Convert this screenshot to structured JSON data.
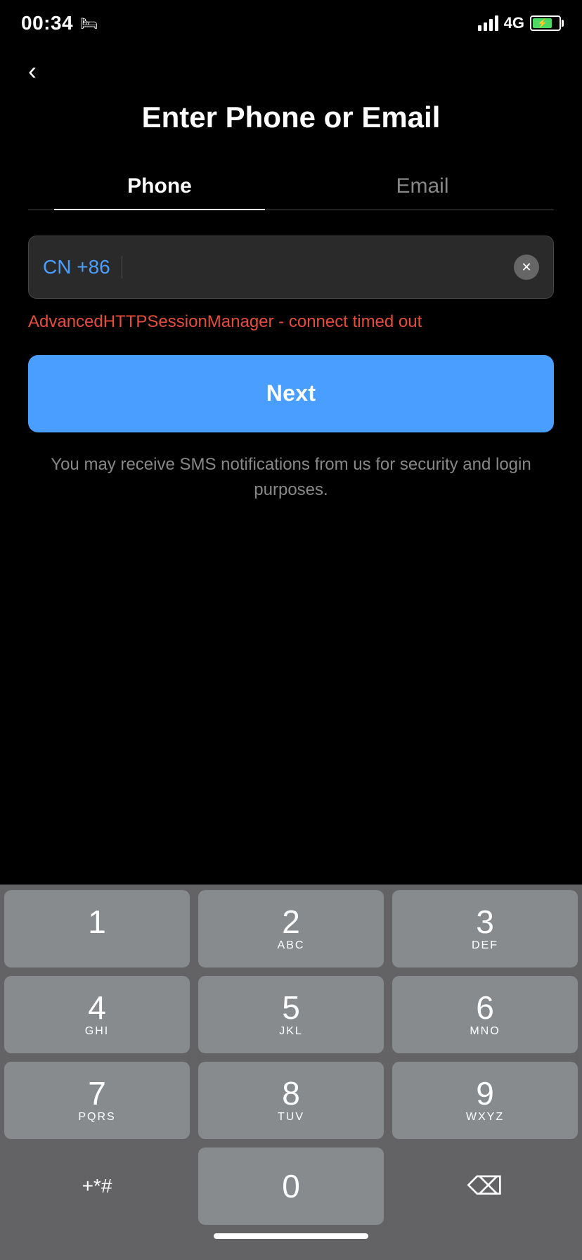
{
  "statusBar": {
    "time": "00:34",
    "network": "4G"
  },
  "header": {
    "title": "Enter Phone or Email",
    "backLabel": "‹"
  },
  "tabs": [
    {
      "id": "phone",
      "label": "Phone",
      "active": true
    },
    {
      "id": "email",
      "label": "Email",
      "active": false
    }
  ],
  "phoneInput": {
    "countryCode": "CN +86",
    "placeholder": "",
    "clearBtnLabel": "✕"
  },
  "error": {
    "message": "AdvancedHTTPSessionManager - connect timed out"
  },
  "nextButton": {
    "label": "Next"
  },
  "smsNotice": {
    "text": "You may receive SMS notifications from us for security and login purposes."
  },
  "keypad": {
    "rows": [
      [
        {
          "num": "1",
          "letters": ""
        },
        {
          "num": "2",
          "letters": "ABC"
        },
        {
          "num": "3",
          "letters": "DEF"
        }
      ],
      [
        {
          "num": "4",
          "letters": "GHI"
        },
        {
          "num": "5",
          "letters": "JKL"
        },
        {
          "num": "6",
          "letters": "MNO"
        }
      ],
      [
        {
          "num": "7",
          "letters": "PQRS"
        },
        {
          "num": "8",
          "letters": "TUV"
        },
        {
          "num": "9",
          "letters": "WXYZ"
        }
      ]
    ],
    "specialLeft": "+*#",
    "zero": "0",
    "deleteLabel": "⌫"
  }
}
